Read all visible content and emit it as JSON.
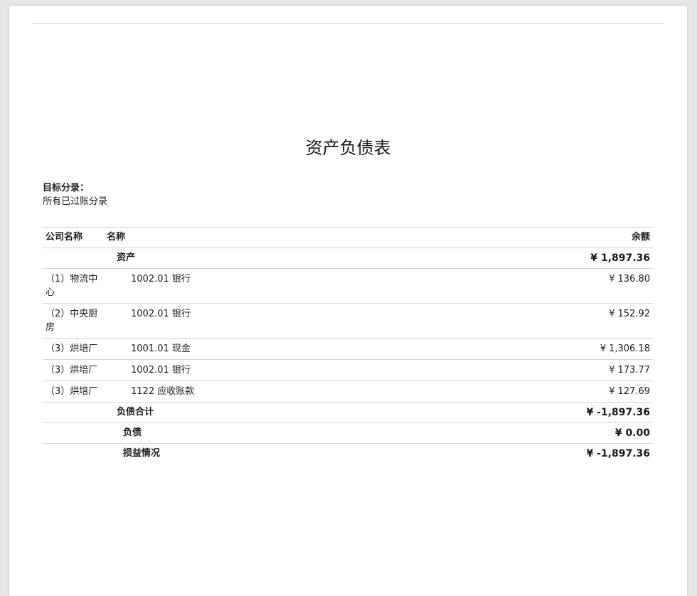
{
  "report": {
    "title": "资产负债表",
    "filter_label": "目标分录：",
    "filter_value": "所有已过账分录"
  },
  "table": {
    "headers": {
      "company": "公司名称",
      "name": "名称",
      "balance": "余额"
    },
    "assets_section": {
      "label": "资产",
      "total": "¥ 1,897.36"
    },
    "lines": [
      {
        "company": "（1）物流中心",
        "account": "1002.01 银行",
        "balance": "¥ 136.80"
      },
      {
        "company": "（2）中央厨房",
        "account": "1002.01 银行",
        "balance": "¥ 152.92"
      },
      {
        "company": "（3）烘培厂",
        "account": "1001.01 现金",
        "balance": "¥ 1,306.18"
      },
      {
        "company": "（3）烘培厂",
        "account": "1002.01 银行",
        "balance": "¥ 173.77"
      },
      {
        "company": "（3）烘培厂",
        "account": "1122 应收账款",
        "balance": "¥ 127.69"
      }
    ],
    "liabilities_total": {
      "label": "负债合计",
      "total": "¥ -1,897.36"
    },
    "liabilities": {
      "label": "负债",
      "total": "¥ 0.00"
    },
    "profit_loss": {
      "label": "损益情况",
      "total": "¥ -1,897.36"
    }
  }
}
